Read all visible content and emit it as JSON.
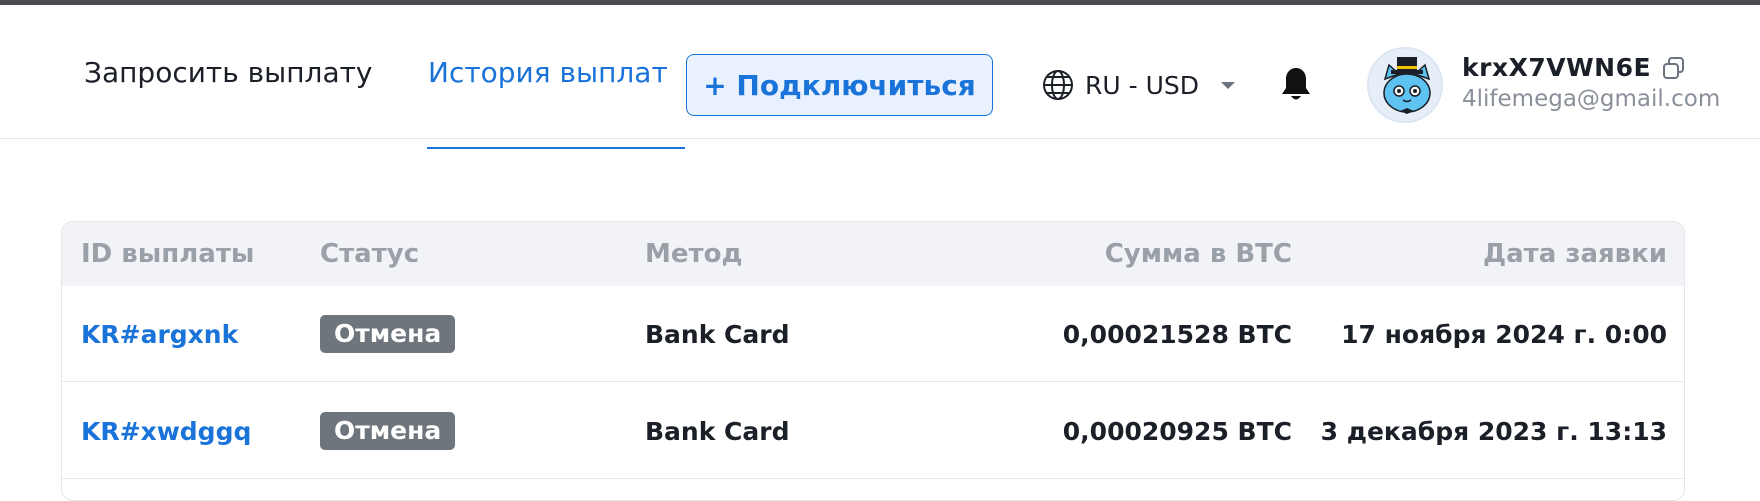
{
  "nav": {
    "request_payout": "Запросить выплату",
    "payout_history": "История выплат"
  },
  "header": {
    "connect_button": "+ Подключиться",
    "language_currency": "RU - USD",
    "username": "krxX7VWN6E",
    "email": "4lifemega@gmail.com"
  },
  "icons": {
    "globe": "globe-icon",
    "caret": "chevron-down-icon",
    "bell": "bell-icon",
    "copy": "copy-icon",
    "avatar": "cat-avatar"
  },
  "colors": {
    "accent": "#1a73d9",
    "badge": "#6f757c",
    "header_text_muted": "#9aa0a8"
  },
  "table": {
    "headers": {
      "id": "ID выплаты",
      "status": "Статус",
      "method": "Метод",
      "amount": "Сумма в BTC",
      "date": "Дата заявки"
    },
    "rows": [
      {
        "id": "KR#argxnk",
        "status": "Отмена",
        "method": "Bank Card",
        "amount": "0,00021528 BTC",
        "date": "17 ноября 2024 г. 0:00"
      },
      {
        "id": "KR#xwdggq",
        "status": "Отмена",
        "method": "Bank Card",
        "amount": "0,00020925 BTC",
        "date": "3 декабря 2023 г. 13:13"
      }
    ]
  }
}
